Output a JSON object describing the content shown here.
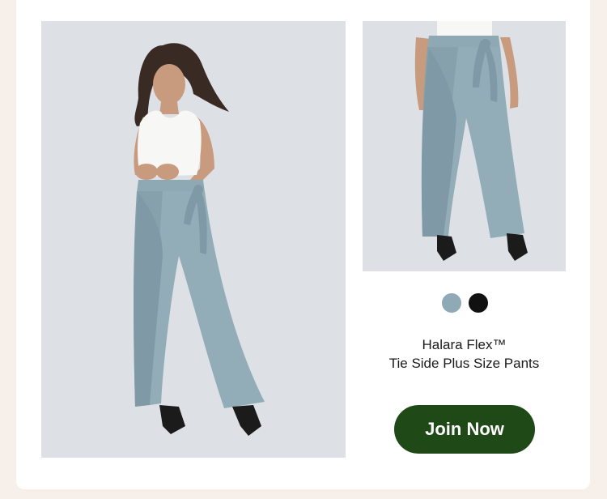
{
  "product": {
    "name_line1": "Halara Flex™",
    "name_line2": "Tie Side Plus Size Pants"
  },
  "swatches": [
    {
      "name": "blue-gray",
      "color": "#8fa9b5"
    },
    {
      "name": "black",
      "color": "#111111"
    }
  ],
  "cta": {
    "label": "Join Now"
  },
  "colors": {
    "page_background": "#f6efea",
    "card_background": "#ffffff",
    "photo_background": "#dde1e6",
    "pants": "#8ea9b4",
    "button": "#1f4a18"
  }
}
